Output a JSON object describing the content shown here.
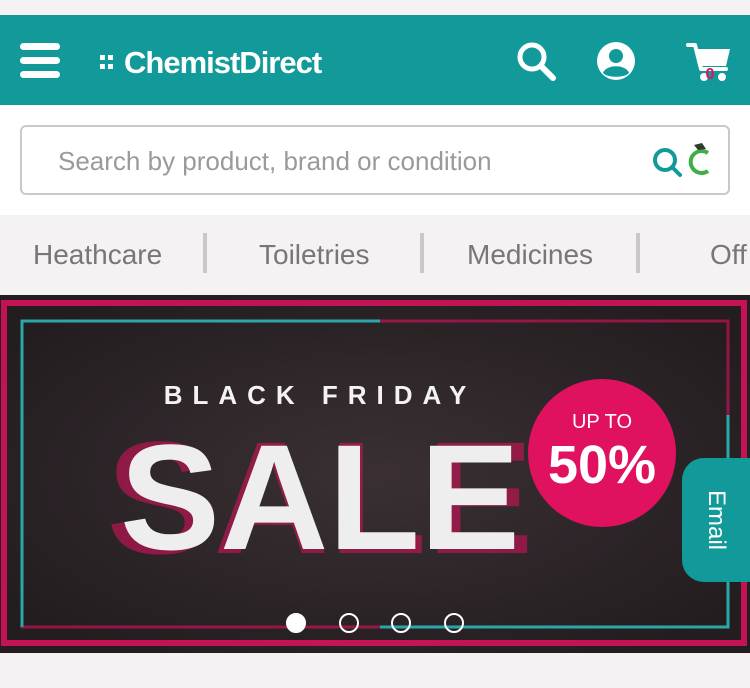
{
  "header": {
    "brand": "ChemistDirect",
    "cart_count": "0",
    "icons": [
      "menu-icon",
      "search-icon",
      "account-icon",
      "cart-icon"
    ]
  },
  "search": {
    "placeholder": "Search by product, brand or condition",
    "value": "",
    "action_icon": "search-scan-icon"
  },
  "nav": {
    "items": [
      {
        "label": "Heathcare"
      },
      {
        "label": "Toiletries"
      },
      {
        "label": "Medicines"
      },
      {
        "label": "Off"
      }
    ]
  },
  "banner": {
    "eyebrow": "BLACK FRIDAY",
    "headline": "SALE",
    "badge_top": "UP TO",
    "badge_value": "50%",
    "slide_count": 4,
    "active_slide": 1
  },
  "email_tab": {
    "label": "Email"
  },
  "colors": {
    "brand": "#12999a",
    "accent": "#e0115f",
    "banner_bg": "#2b2427",
    "banner_frame_pink": "#e0115f",
    "banner_frame_teal": "#2aa7a8"
  }
}
